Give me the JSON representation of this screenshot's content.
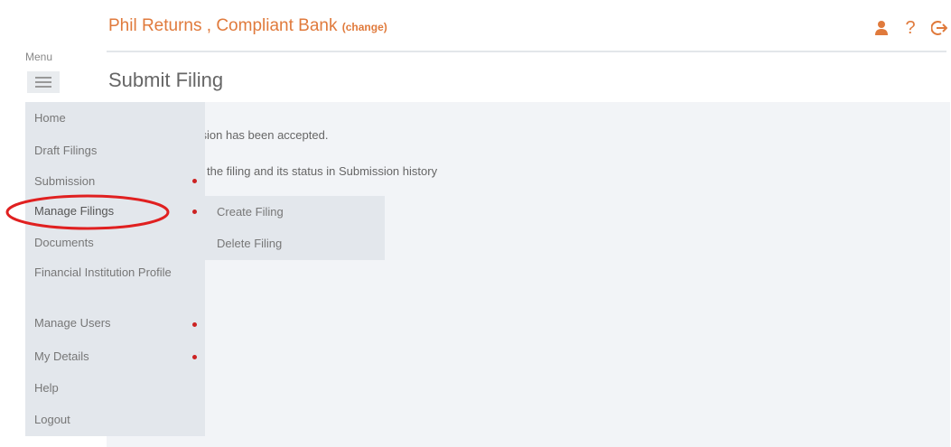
{
  "header": {
    "title": "Phil Returns , Compliant Bank",
    "change_label": "(change)",
    "icons": [
      "user-icon",
      "help-icon",
      "logout-icon"
    ],
    "help_glyph": "?"
  },
  "menu": {
    "label": "Menu",
    "toggle_icon": "hamburger-icon"
  },
  "page": {
    "title": "Submit Filing",
    "message_1": "ssion has been accepted.",
    "message_2": "w the filing and its status in Submission history"
  },
  "sidebar": {
    "items": [
      {
        "label": "Home"
      },
      {
        "label": "Draft Filings"
      },
      {
        "label": "Submission",
        "has_submenu": true
      },
      {
        "label": "Manage Filings",
        "has_submenu": true,
        "active": true
      },
      {
        "label": "Documents"
      },
      {
        "label": "Financial Institution Profile"
      },
      {
        "label": "Manage Users",
        "has_submenu": true
      },
      {
        "label": "My Details",
        "has_submenu": true
      },
      {
        "label": "Help"
      },
      {
        "label": "Logout"
      }
    ]
  },
  "submenu": {
    "items": [
      {
        "label": "Create Filing"
      },
      {
        "label": "Delete Filing"
      }
    ]
  },
  "colors": {
    "accent": "#e07a3c",
    "submenu_dot": "#cc2222",
    "annotation": "#e02020",
    "sidebar_bg": "#e3e7ec",
    "panel_bg": "#f2f4f7"
  }
}
